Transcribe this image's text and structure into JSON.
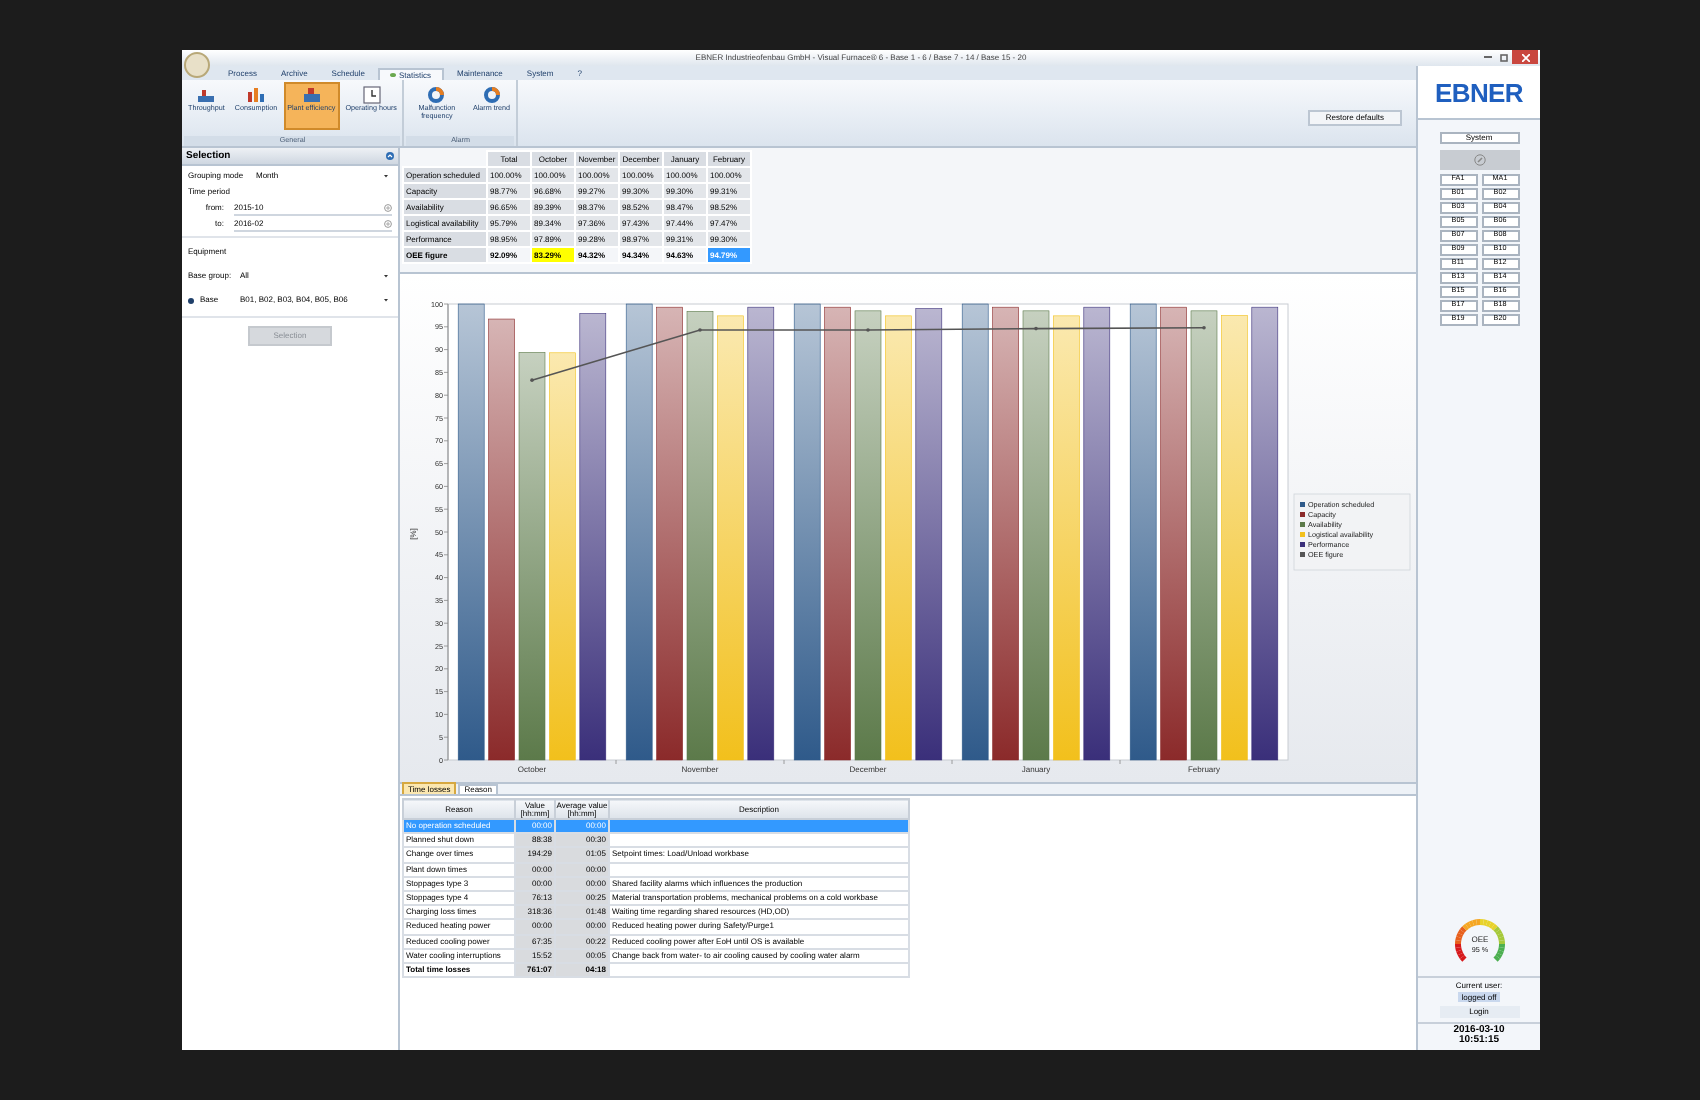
{
  "window": {
    "title": "EBNER Industrieofenbau GmbH - Visual Furnace® 6 - Base 1 - 6 / Base 7 - 14 / Base 15 - 20"
  },
  "menu": [
    {
      "label": "Process",
      "selected": false
    },
    {
      "label": "Archive",
      "selected": false
    },
    {
      "label": "Schedule",
      "selected": false
    },
    {
      "label": "Statistics",
      "selected": true
    },
    {
      "label": "Maintenance",
      "selected": false
    },
    {
      "label": "System",
      "selected": false
    },
    {
      "label": "?",
      "selected": false
    }
  ],
  "ribbon": {
    "groups": [
      {
        "label": "General",
        "buttons": [
          {
            "label": "Throughput",
            "kind": "throughput",
            "selected": false
          },
          {
            "label": "Consumption",
            "kind": "consumption",
            "selected": false
          },
          {
            "label": "Plant efficiency",
            "kind": "efficiency",
            "selected": true
          },
          {
            "label": "Operating hours",
            "kind": "hours",
            "selected": false
          }
        ]
      },
      {
        "label": "Alarm",
        "buttons": [
          {
            "label": "Malfunction frequency",
            "kind": "ring",
            "selected": false
          },
          {
            "label": "Alarm trend",
            "kind": "ring",
            "selected": false
          }
        ]
      }
    ],
    "restore_button": "Restore defaults"
  },
  "selection": {
    "title": "Selection",
    "grouping_label": "Grouping mode",
    "grouping_value": "Month",
    "time_period": "Time period",
    "from_label": "from:",
    "from_value": "2015-10",
    "to_label": "to:",
    "to_value": "2016-02",
    "equipment": "Equipment",
    "base_group_label": "Base group:",
    "base_group_value": "All",
    "base_label": "Base",
    "base_selected": true,
    "base_value": "B01, B02, B03, B04, B05, B06",
    "button": {
      "label": "Selection",
      "disabled": true
    }
  },
  "oee_table": {
    "columns": [
      "Total",
      "October",
      "November",
      "December",
      "January",
      "February"
    ],
    "rows": [
      {
        "label": "Operation scheduled",
        "kind": "normal",
        "cells": [
          "100.00%",
          "100.00%",
          "100.00%",
          "100.00%",
          "100.00%",
          "100.00%"
        ]
      },
      {
        "label": "Capacity",
        "kind": "normal",
        "cells": [
          "98.77%",
          "96.68%",
          "99.27%",
          "99.30%",
          "99.30%",
          "99.31%"
        ]
      },
      {
        "label": "Availability",
        "kind": "normal",
        "cells": [
          "96.65%",
          "89.39%",
          "98.37%",
          "98.52%",
          "98.47%",
          "98.52%"
        ]
      },
      {
        "label": "Logistical availability",
        "kind": "normal",
        "cells": [
          "95.79%",
          "89.34%",
          "97.36%",
          "97.43%",
          "97.44%",
          "97.47%"
        ]
      },
      {
        "label": "Performance",
        "kind": "normal",
        "cells": [
          "98.95%",
          "97.89%",
          "99.28%",
          "98.97%",
          "99.31%",
          "99.30%"
        ]
      },
      {
        "label": "OEE figure",
        "kind": "total",
        "cells": [
          {
            "text": "92.09%",
            "warning": false,
            "selected": false
          },
          {
            "text": "83.29%",
            "warning": true,
            "selected": false
          },
          {
            "text": "94.32%",
            "warning": false,
            "selected": false
          },
          {
            "text": "94.34%",
            "warning": false,
            "selected": false
          },
          {
            "text": "94.63%",
            "warning": false,
            "selected": false
          },
          {
            "text": "94.79%",
            "warning": false,
            "selected": true
          }
        ]
      }
    ]
  },
  "chart": {
    "chart_data": {
      "type": "bar",
      "ylabel": "[%]",
      "categories": [
        "October",
        "November",
        "December",
        "January",
        "February"
      ],
      "stacked": false,
      "legend": "right",
      "ylim": [
        0,
        100
      ],
      "yticks": [
        0,
        5,
        10,
        15,
        20,
        25,
        30,
        35,
        40,
        45,
        50,
        55,
        60,
        65,
        70,
        75,
        80,
        85,
        90,
        95,
        100
      ],
      "series": [
        {
          "name": "Operation scheduled",
          "color": "#2f5a8a",
          "values": [
            100,
            100,
            100,
            100,
            100
          ]
        },
        {
          "name": "Capacity",
          "color": "#8b2a2a",
          "values": [
            96.7,
            99.3,
            99.3,
            99.3,
            99.3
          ]
        },
        {
          "name": "Availability",
          "color": "#5c7a4a",
          "values": [
            89.4,
            98.4,
            98.5,
            98.5,
            98.5
          ]
        },
        {
          "name": "Logistical availability",
          "color": "#f2c01c",
          "values": [
            89.3,
            97.4,
            97.4,
            97.4,
            97.5
          ]
        },
        {
          "name": "Performance",
          "color": "#3a2f7a",
          "values": [
            97.9,
            99.3,
            99.0,
            99.3,
            99.3
          ]
        },
        {
          "name": "OEE figure",
          "type": "line",
          "color": "#555555",
          "values": [
            83.3,
            94.3,
            94.3,
            94.6,
            94.8
          ]
        }
      ]
    }
  },
  "time_losses": {
    "tabs": [
      {
        "label": "Time losses",
        "selected": true
      },
      {
        "label": "Reason",
        "selected": false
      }
    ],
    "columns": [
      "Reason",
      "Value [hh:mm]",
      "Average value [hh:mm]",
      "Description"
    ],
    "rows": [
      {
        "reason": "No operation scheduled",
        "value": "00:00",
        "average": "00:00",
        "description": "",
        "selected": true
      },
      {
        "reason": "Planned shut down",
        "value": "88:38",
        "average": "00:30",
        "description": "",
        "selected": false
      },
      {
        "reason": "Change over times",
        "value": "194:29",
        "average": "01:05",
        "description": "Setpoint times: Load/Unload workbase",
        "selected": false
      },
      {
        "reason": "Plant down times",
        "value": "00:00",
        "average": "00:00",
        "description": "",
        "selected": false
      },
      {
        "reason": "Stoppages type 3",
        "value": "00:00",
        "average": "00:00",
        "description": "Shared facility alarms which influences the production",
        "selected": false
      },
      {
        "reason": "Stoppages type 4",
        "value": "76:13",
        "average": "00:25",
        "description": "Material transportation problems, mechanical problems on a cold workbase",
        "selected": false
      },
      {
        "reason": "Charging loss times",
        "value": "318:36",
        "average": "01:48",
        "description": "Waiting time regarding shared resources (HD,OD)",
        "selected": false
      },
      {
        "reason": "Reduced heating power",
        "value": "00:00",
        "average": "00:00",
        "description": "Reduced heating power during Safety/Purge1",
        "selected": false
      },
      {
        "reason": "Reduced cooling power",
        "value": "67:35",
        "average": "00:22",
        "description": "Reduced cooling power after EoH until OS is available",
        "selected": false
      },
      {
        "reason": "Water cooling interruptions",
        "value": "15:52",
        "average": "00:05",
        "description": "Change back from water- to air cooling caused by cooling water alarm",
        "selected": false
      }
    ],
    "total": {
      "reason": "Total time losses",
      "value": "761:07",
      "average": "04:18"
    }
  },
  "sidebar": {
    "logo": "EBNER",
    "system_button": "System",
    "stations": [
      "FA1",
      "MA1",
      "B01",
      "B02",
      "B03",
      "B04",
      "B05",
      "B06",
      "B07",
      "B08",
      "B09",
      "B10",
      "B11",
      "B12",
      "B13",
      "B14",
      "B15",
      "B16",
      "B17",
      "B18",
      "B19",
      "B20"
    ],
    "gauge": {
      "label": "OEE",
      "reading": "95 %"
    },
    "user_label": "Current user:",
    "user_status": "logged off",
    "login_button": "Login",
    "date": "2016-03-10",
    "time": "10:51:15"
  }
}
